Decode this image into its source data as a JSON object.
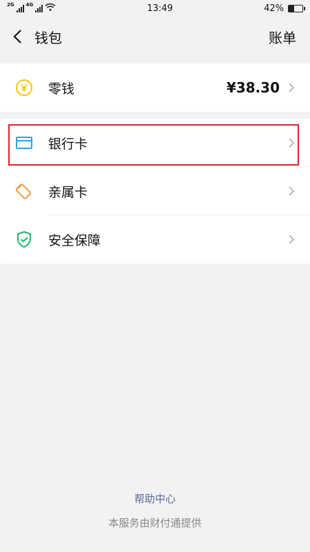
{
  "status_bar": {
    "net_2g": "2G",
    "net_4g": "4G",
    "time": "13:49",
    "battery_percent": "42%",
    "battery_level": 0.42
  },
  "nav": {
    "title": "钱包",
    "right_action": "账单"
  },
  "balance": {
    "label": "零钱",
    "amount": "¥38.30",
    "icon": "yen-coin-icon",
    "icon_color": "#f5c400"
  },
  "menu": [
    {
      "label": "银行卡",
      "icon": "bank-card-icon",
      "icon_color": "#2aa0e8"
    },
    {
      "label": "亲属卡",
      "icon": "family-card-icon",
      "icon_color": "#f39a3a"
    },
    {
      "label": "安全保障",
      "icon": "shield-check-icon",
      "icon_color": "#19b96c"
    }
  ],
  "footer": {
    "help": "帮助中心",
    "provider": "本服务由财付通提供"
  },
  "colors": {
    "background": "#f2f2f2",
    "link": "#576b95",
    "highlight": "#e0202a"
  }
}
